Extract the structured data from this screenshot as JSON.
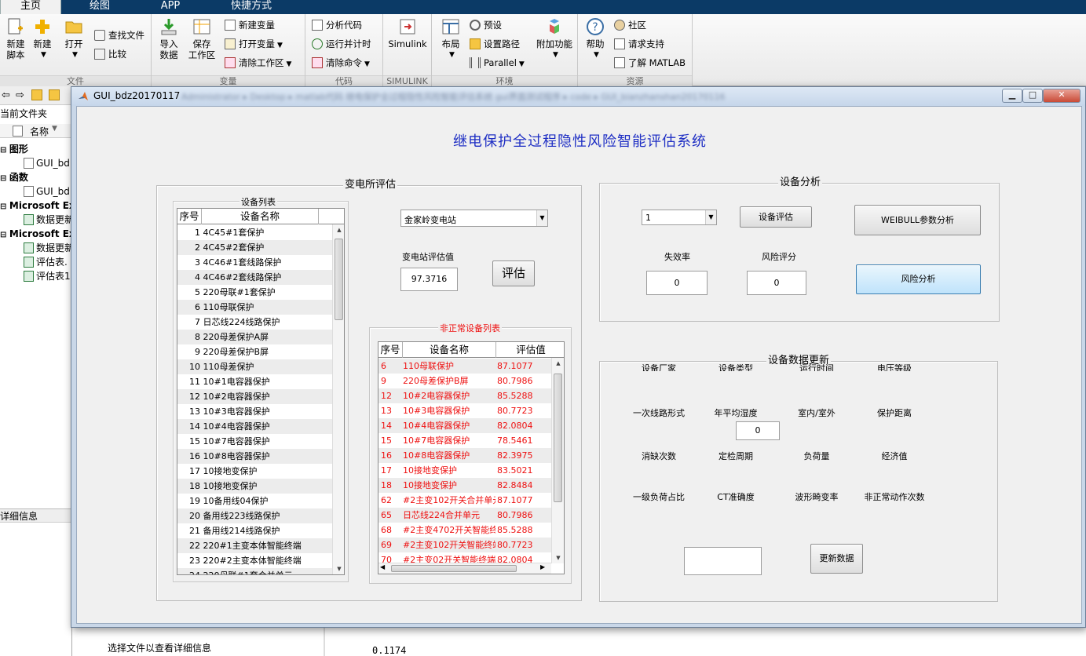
{
  "matlab": {
    "tabs": [
      "主页",
      "绘图",
      "APP",
      "快捷方式"
    ],
    "groups": {
      "file": "文件",
      "variable": "变量",
      "code": "代码",
      "simulink": "SIMULINK",
      "env": "环境",
      "resources": "资源"
    },
    "buttons": {
      "new_script_1": "新建",
      "new_script_2": "脚本",
      "new": "新建",
      "open": "打开",
      "find_files": "查找文件",
      "compare": "比较",
      "import_1": "导入",
      "import_2": "数据",
      "save_1": "保存",
      "save_2": "工作区",
      "new_var": "新建变量",
      "open_var": "打开变量",
      "clear_ws": "清除工作区",
      "analyze": "分析代码",
      "run_time": "运行并计时",
      "clear_cmd": "清除命令",
      "simulink": "Simulink",
      "layout": "布局",
      "prefs": "预设",
      "set_path": "设置路径",
      "parallel": "Parallel",
      "addons": "附加功能",
      "help": "帮助",
      "community": "社区",
      "support": "请求支持",
      "learn": "了解 MATLAB"
    },
    "left_pane": {
      "current_folder": "当前文件夹",
      "name_header": "名称",
      "items": [
        {
          "label": "图形",
          "bold": true,
          "type": "group"
        },
        {
          "label": "GUI_bd",
          "type": "fig"
        },
        {
          "label": "函数",
          "bold": true,
          "type": "group"
        },
        {
          "label": "GUI_bd",
          "type": "m"
        },
        {
          "label": "Microsoft Exc",
          "bold": true,
          "type": "group"
        },
        {
          "label": "数据更新",
          "type": "xls"
        },
        {
          "label": "Microsoft Exc",
          "bold": true,
          "type": "group"
        },
        {
          "label": "数据更新",
          "type": "xls"
        },
        {
          "label": "评估表.",
          "type": "xls"
        },
        {
          "label": "评估表1",
          "type": "xls"
        }
      ],
      "details": "详细信息"
    },
    "bottom": {
      "select_file": "选择文件以查看详细信息",
      "cmd_value": "0.1174"
    }
  },
  "figure": {
    "window_title": "GUI_bdz20170117",
    "path_blurred": "Administrator ▸ Desktop ▸ matlab代码 继电保护全过程隐性风险智能评估系统 gui界面测试程序 ▸ code ▸ GUI_bianzhanshan20170116",
    "main_title": "继电保护全过程隐性风险智能评估系统",
    "substation": {
      "panel_title": "变电所评估",
      "device_list_title": "设备列表",
      "columns": [
        "序号",
        "设备名称"
      ],
      "devices": [
        "1 4C45#1套保护",
        "2 4C45#2套保护",
        "3 4C46#1套线路保护",
        "4 4C46#2套线路保护",
        "5 220母联#1套保护",
        "6 110母联保护",
        "7 日芯线224线路保护",
        "8 220母差保护A屏",
        "9 220母差保护B屏",
        "10 110母差保护",
        "11 10#1电容器保护",
        "12 10#2电容器保护",
        "13 10#3电容器保护",
        "14 10#4电容器保护",
        "15 10#7电容器保护",
        "16 10#8电容器保护",
        "17 10接地变保护",
        "18 10接地变保护",
        "19 10备用线04保护",
        "20 备用线223线路保护",
        "21 备用线214线路保护",
        "22 220#1主变本体智能终端",
        "23 220#2主变本体智能终端",
        "24 220母联#1套合并单元"
      ],
      "station_select": "金家岭变电站",
      "eval_label": "变电站评估值",
      "eval_value": "97.3716",
      "eval_button": "评估",
      "abnormal_title": "非正常设备列表",
      "abnormal_columns": [
        "序号",
        "设备名称",
        "评估值"
      ],
      "abnormal": [
        [
          "6",
          "110母联保护",
          "87.1077"
        ],
        [
          "9",
          "220母差保护B屏",
          "80.7986"
        ],
        [
          "12",
          "10#2电容器保护",
          "85.5288"
        ],
        [
          "13",
          "10#3电容器保护",
          "80.7723"
        ],
        [
          "14",
          "10#4电容器保护",
          "82.0804"
        ],
        [
          "15",
          "10#7电容器保护",
          "78.5461"
        ],
        [
          "16",
          "10#8电容器保护",
          "82.3975"
        ],
        [
          "17",
          "10接地变保护",
          "83.5021"
        ],
        [
          "18",
          "10接地变保护",
          "82.8484"
        ],
        [
          "62",
          "#2主变102开关合并单元",
          "87.1077"
        ],
        [
          "65",
          "日芯线224合并单元",
          "80.7986"
        ],
        [
          "68",
          "#2主变4702开关智能终端",
          "85.5288"
        ],
        [
          "69",
          "#2主变102开关智能终端",
          "80.7723"
        ],
        [
          "70",
          "#2主变02开关智能终端",
          "82.0804"
        ]
      ]
    },
    "device_analysis": {
      "panel_title": "设备分析",
      "select_value": "1",
      "eval_button": "设备评估",
      "weibull_button": "WEIBULL参数分析",
      "failure_label": "失效率",
      "failure_value": "0",
      "risk_label": "风险评分",
      "risk_value": "0",
      "risk_button": "风险分析"
    },
    "data_update": {
      "panel_title": "设备数据更新",
      "row1": [
        "设备厂家",
        "设备类型",
        "运行时间",
        "电压等级"
      ],
      "row2": [
        "一次线路形式",
        "年平均湿度",
        "室内/室外",
        "保护距离"
      ],
      "humidity_value": "0",
      "row3": [
        "消缺次数",
        "定检周期",
        "负荷量",
        "经济值"
      ],
      "row4": [
        "一级负荷占比",
        "CT准确度",
        "波形畸变率",
        "非正常动作次数"
      ],
      "input_value": "",
      "update_button": "更新数据"
    }
  }
}
